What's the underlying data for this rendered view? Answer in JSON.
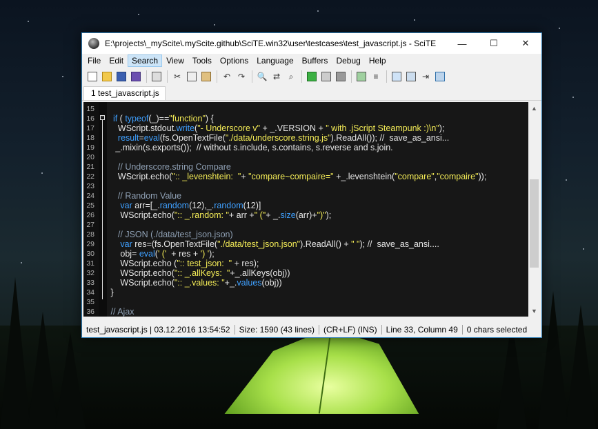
{
  "window": {
    "title": "E:\\projects\\_myScite\\.myScite.github\\SciTE.win32\\user\\testcases\\test_javascript.js - SciTE",
    "minimize": "—",
    "maximize": "☐",
    "close": "✕"
  },
  "menu": [
    "File",
    "Edit",
    "Search",
    "View",
    "Tools",
    "Options",
    "Language",
    "Buffers",
    "Debug",
    "Help"
  ],
  "active_menu": "Search",
  "tab": {
    "label": "1 test_javascript.js"
  },
  "editor": {
    "lines": [
      {
        "n": "15",
        "code": ""
      },
      {
        "n": "16",
        "fold": true,
        "code": "  <kw>if</kw> ( <kw>typeof</kw>(_)==<str>\"function\"</str>) {"
      },
      {
        "n": "17",
        "code": "    WScript.stdout.<kw>write</kw>(<str>\"- Underscore v\"</str> + _.VERSION + <str>\" with .jScript Steampunk :)\\n\"</str>);"
      },
      {
        "n": "18",
        "code": "    <kw>result</kw>=<kw>eval</kw>(fs.OpenTextFile(<str>\"./data/underscore.string.js\"</str>).ReadAll()); //  save_as_ansi..."
      },
      {
        "n": "19",
        "code": "   _.mixin(s.exports());  // without s.include, s.contains, s.reverse and s.join."
      },
      {
        "n": "20",
        "code": ""
      },
      {
        "n": "21",
        "code": "    <cm>// Underscore.string Compare</cm>"
      },
      {
        "n": "22",
        "code": "    WScript.echo(<str>\":: _levenshtein:  \"</str>+ <str>\"compare~compaire=\"</str> +_.levenshtein(<str>\"compare\"</str>,<str>\"compaire\"</str>));"
      },
      {
        "n": "23",
        "code": ""
      },
      {
        "n": "24",
        "code": "    <cm>// Random Value</cm>"
      },
      {
        "n": "25",
        "code": "     <kw>var</kw> arr=[_.<kw>random</kw>(12),_.<kw>random</kw>(12)]"
      },
      {
        "n": "26",
        "code": "     WScript.echo(<str>\":: _.random: \"</str>+ arr +<str>\" (\"</str>+ _.<kw>size</kw>(arr)+<str>\")\"</str>);"
      },
      {
        "n": "27",
        "code": ""
      },
      {
        "n": "28",
        "code": "    <cm>// JSON (./data/test_json.json)</cm>"
      },
      {
        "n": "29",
        "code": "     <kw>var</kw> res=(fs.OpenTextFile(<str>\"./data/test_json.json\"</str>).ReadAll() + <str>\" \"</str>); //  save_as_ansi...."
      },
      {
        "n": "30",
        "code": "     obj= <kw>eval</kw>(<str>' ('</str>  + res + <str>') '</str>);"
      },
      {
        "n": "31",
        "code": "     WScript.echo (<str>\":: test_json:  \"</str> + res);"
      },
      {
        "n": "32",
        "code": "     WScript.echo(<str>\":: _.allKeys:  \"</str>+_.allKeys(obj))"
      },
      {
        "n": "33",
        "code": "     WScript.echo(<str>\":: _.values: \"</str>+_.<kw>values</kw>(obj))"
      },
      {
        "n": "34",
        "code": " }"
      },
      {
        "n": "35",
        "code": ""
      },
      {
        "n": "36",
        "code": " <cm>// Ajax</cm>"
      }
    ]
  },
  "status": [
    "test_javascript.js | 03.12.2016 13:54:52",
    "Size: 1590 (43 lines)",
    "(CR+LF)  (INS)",
    "Line 33, Column 49",
    "0 chars selected"
  ]
}
